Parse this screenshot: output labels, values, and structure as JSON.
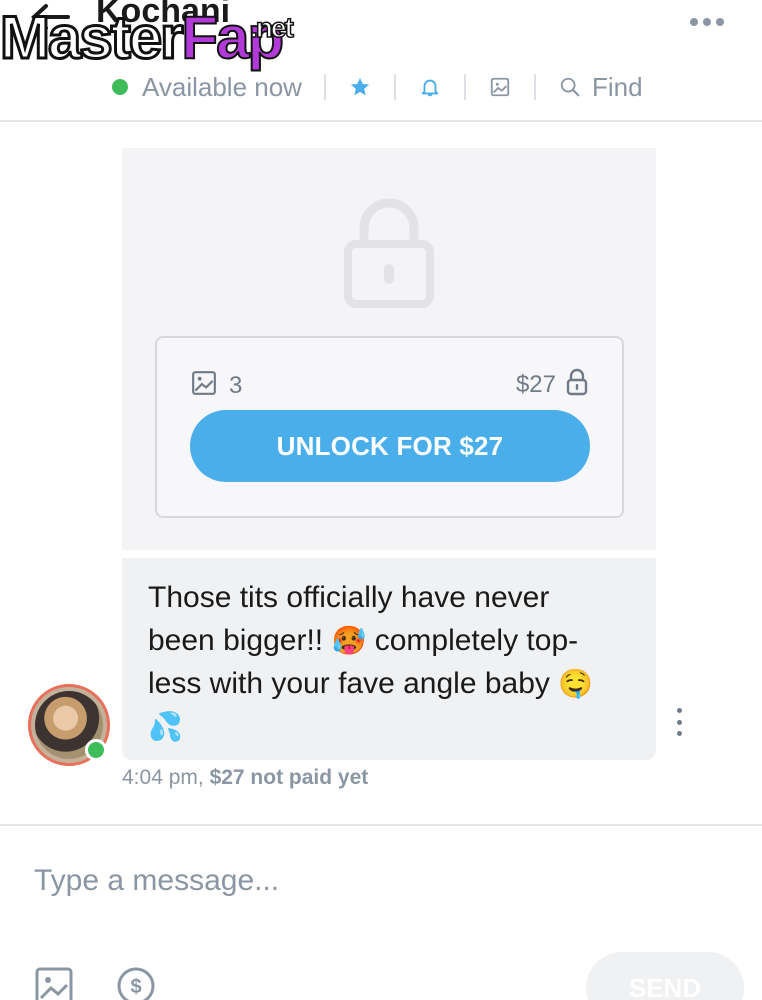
{
  "header": {
    "title": "Kochani",
    "status": "Available now",
    "find_label": "Find"
  },
  "watermark": {
    "master": "Master",
    "fap": "Fap",
    "net": ".net"
  },
  "locked_post": {
    "media_count": "3",
    "price": "$27",
    "unlock_label": "UNLOCK FOR $27"
  },
  "message": {
    "line1": "Those tits officially have never",
    "line2a": "been bigger!!",
    "emoji_hot": "🥵",
    "line2b": "completely top-",
    "line3": "less with your fave angle baby",
    "emoji_drool": "🤤",
    "emoji_drops": "💦",
    "time": "4:04 pm,",
    "payment_status": "$27 not paid yet"
  },
  "composer": {
    "placeholder": "Type a message...",
    "send_label": "SEND"
  },
  "colors": {
    "accent": "#4aaeea",
    "online": "#3fbd5a",
    "muted": "#8a96a3"
  },
  "icons": [
    "back-arrow-icon",
    "more-icon",
    "star-icon",
    "bell-icon",
    "image-icon",
    "search-icon",
    "lock-icon",
    "dollar-icon",
    "kebab-icon"
  ]
}
